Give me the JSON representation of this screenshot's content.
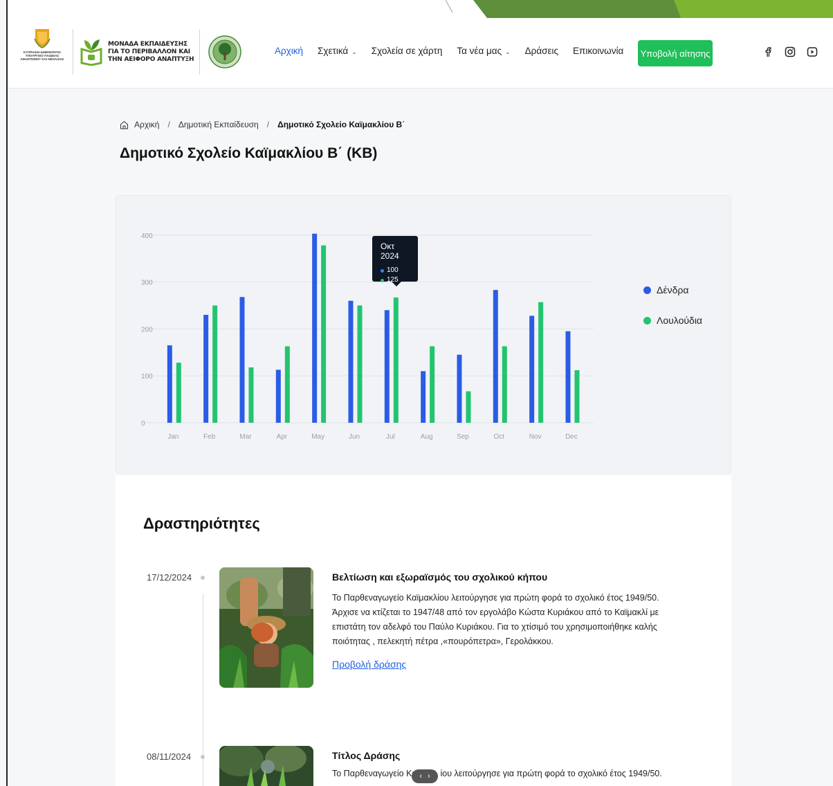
{
  "header": {
    "gov_logo_caption": "ΚΥΠΡΙΑΚΗ ΔΗΜΟΚΡΑΤΙΑ ΥΠΟΥΡΓΕΙΟ ΠΑΙΔΕΙΑΣ ΑΘΛΗΤΙΣΜΟΥ ΚΑΙ ΝΕΟΛΑΙΑΣ",
    "unit_logo_line1": "ΜΟΝΑΔΑ ΕΚΠΑΙΔΕΥΣΗΣ",
    "unit_logo_line2": "ΓΙΑ ΤΟ ΠΕΡΙΒΑΛΛΟΝ ΚΑΙ",
    "unit_logo_line3": "ΤΗΝ ΑΕΙΦΟΡΟ ΑΝΑΠΤΥΞΗ",
    "nav": [
      {
        "label": "Αρχική",
        "active": true
      },
      {
        "label": "Σχετικά",
        "has_dropdown": true
      },
      {
        "label": "Σχολεία σε χάρτη"
      },
      {
        "label": "Τα νέα μας",
        "has_dropdown": true
      },
      {
        "label": "Δράσεις"
      },
      {
        "label": "Επικοινωνία"
      }
    ],
    "cta_label": "Υποβολή αίτησης",
    "social_icons": [
      "facebook-icon",
      "instagram-icon",
      "youtube-icon"
    ]
  },
  "breadcrumb": {
    "home": "Αρχική",
    "level2": "Δημοτική Εκπαίδευση",
    "current": "Δημοτικό Σχολείο Καϊμακλίου Β΄"
  },
  "page_title": "Δημοτικό Σχολείο Καϊμακλίου Β΄ (ΚΒ)",
  "colors": {
    "accent_blue": "#2b5ce6",
    "accent_green": "#22c470",
    "cta_green": "#1fbf5a",
    "link_blue": "#1f5fe0"
  },
  "chart_data": {
    "type": "bar",
    "categories": [
      "Jan",
      "Feb",
      "Mar",
      "Apr",
      "May",
      "Jun",
      "Jul",
      "Aug",
      "Sep",
      "Oct",
      "Nov",
      "Dec"
    ],
    "series": [
      {
        "name": "Δένδρα",
        "color": "#2b5ce6",
        "values": [
          165,
          230,
          268,
          113,
          403,
          260,
          240,
          110,
          145,
          283,
          228,
          195
        ]
      },
      {
        "name": "Λουλούδια",
        "color": "#22c470",
        "values": [
          128,
          250,
          118,
          163,
          378,
          250,
          267,
          163,
          67,
          163,
          257,
          112
        ]
      }
    ],
    "yticks": [
      0,
      100,
      200,
      300,
      400
    ],
    "ylim": [
      0,
      410
    ],
    "grid": true,
    "legend_position": "right",
    "tooltip": {
      "title": "Οκτ 2024",
      "value1": "100",
      "value2": "125"
    }
  },
  "activities": {
    "title": "Δραστηριότητες",
    "items": [
      {
        "date": "17/12/2024",
        "title": "Βελτίωση και εξωραϊσμός του σχολικού κήπου",
        "desc_lines": [
          "Το Παρθεναγωγείο Καϊμακλίου λειτούργησε για πρώτη φορά το σχολικό έτος 1949/50.",
          "Άρχισε να κτίζεται το 1947/48 από τον εργολάβο Κώστα Κυριάκου από το Καϊμακλί με",
          "επιστάτη τον αδελφό του Παύλο Κυριάκου. Για το χτίσιμό του χρησιμοποιήθηκε καλής",
          "ποιότητας , πελεκητή πέτρα ,«πουρόπετρα», Γερολάκκου."
        ],
        "link": "Προβολή δράσης"
      },
      {
        "date": "08/11/2024",
        "title": "Τίτλος Δράσης",
        "desc_lines": [
          "Το Παρθεναγωγείο Κα",
          "ίου λειτούργησε για πρώτη φορά το σχολικό έτος 1949/50."
        ]
      }
    ]
  },
  "pager": {
    "prev": "‹",
    "next": "›"
  }
}
